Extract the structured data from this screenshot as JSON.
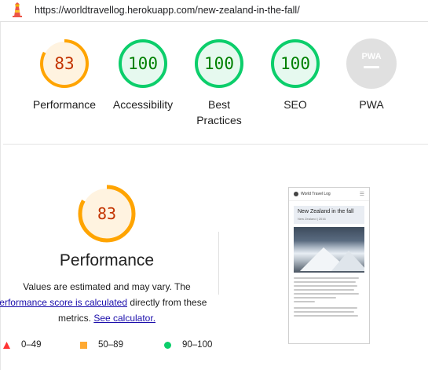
{
  "url_bar": {
    "url": "https://worldtravellog.herokuapp.com/new-zealand-in-the-fall/"
  },
  "gauges": [
    {
      "score": "83",
      "label": "Performance",
      "fraction": 0.83,
      "status": "average"
    },
    {
      "score": "100",
      "label": "Accessibility",
      "fraction": 1.0,
      "status": "pass"
    },
    {
      "score": "100",
      "label": "Best Practices",
      "fraction": 1.0,
      "status": "pass"
    },
    {
      "score": "100",
      "label": "SEO",
      "fraction": 1.0,
      "status": "pass"
    },
    {
      "score": "",
      "label": "PWA",
      "badge_text": "PWA",
      "status": "na"
    }
  ],
  "performance": {
    "score": "83",
    "fraction": 0.83,
    "title": "Performance",
    "desc_part1": "Values are estimated and may vary. The",
    "desc_link1": "performance score is calculated",
    "desc_part2": " directly from these",
    "desc_part3": "metrics. ",
    "desc_link2": "See calculator."
  },
  "legend": [
    {
      "range": "0–49",
      "shape": "triangle",
      "color": "#ff3333"
    },
    {
      "range": "50–89",
      "shape": "square",
      "color": "#ffaa33"
    },
    {
      "range": "90–100",
      "shape": "circle",
      "color": "#0cce6b"
    }
  ],
  "thumbnail": {
    "site_name": "World Travel Log",
    "post_title": "New Zealand in the fall",
    "post_meta": "New Zealand | 2016"
  },
  "colors": {
    "fail": "#ff3333",
    "average": "#ffa400",
    "average_fill": "#fff3e0",
    "average_text": "#c33300",
    "pass": "#0cce6b",
    "pass_fill": "#e6f9ef",
    "pass_text": "#008000",
    "na": "#e0e0e0",
    "link": "#1a0dab"
  }
}
